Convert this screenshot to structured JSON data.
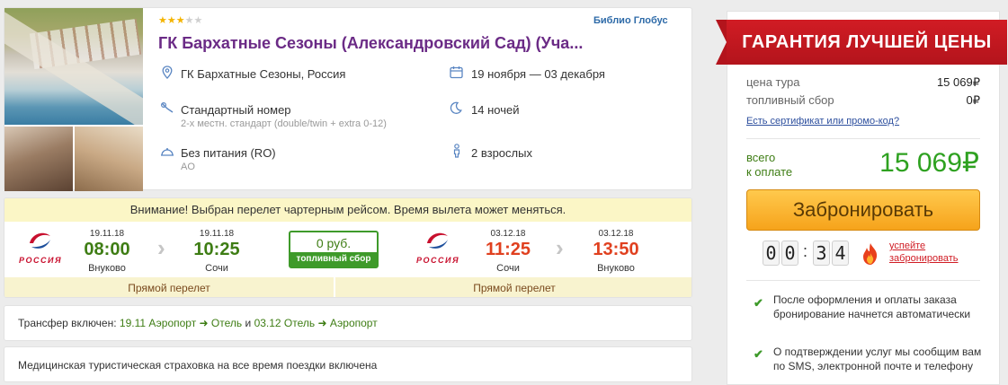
{
  "hotel": {
    "stars_filled": 3,
    "stars_total": 5,
    "operator": "Библио Глобус",
    "title": "ГК Бархатные Сезоны (Александровский Сад) (Уча...",
    "location": "ГК Бархатные Сезоны, Россия",
    "dates": "19 ноября — 03 декабря",
    "room": "Стандартный номер",
    "room_detail": "2-х местн. стандарт (double/twin + extra 0-12)",
    "nights": "14 ночей",
    "meal": "Без питания (RO)",
    "meal_code": "AO",
    "guests": "2 взрослых"
  },
  "flight": {
    "notice": "Внимание! Выбран перелет чартерным рейсом. Время вылета может меняться.",
    "airline": "РОССИЯ",
    "outbound": {
      "dep_date": "19.11.18",
      "dep_time": "08:00",
      "dep_place": "Внуково",
      "arr_date": "19.11.18",
      "arr_time": "10:25",
      "arr_place": "Сочи",
      "label": "Прямой перелет"
    },
    "fuel": {
      "price": "0 руб.",
      "label": "топливный сбор"
    },
    "return": {
      "dep_date": "03.12.18",
      "dep_time": "11:25",
      "dep_place": "Сочи",
      "arr_date": "03.12.18",
      "arr_time": "13:50",
      "arr_place": "Внуково",
      "label": "Прямой перелет"
    }
  },
  "transfer": {
    "prefix": "Трансфер включен:",
    "out": "19.11 Аэропорт ➜ Отель",
    "and": "и",
    "back": "03.12 Отель ➜ Аэропорт"
  },
  "insurance": "Медицинская туристическая страховка на все время поездки включена",
  "sidebar": {
    "ribbon": "ГАРАНТИЯ ЛУЧШЕЙ ЦЕНЫ",
    "tour_price_label": "цена тура",
    "tour_price_value": "15 069₽",
    "fuel_label": "топливный сбор",
    "fuel_value": "0₽",
    "promo_link": "Есть сертификат или промо-код?",
    "total_label_1": "всего",
    "total_label_2": "к оплате",
    "total_value": "15 069₽",
    "book_button": "Забронировать",
    "timer": [
      "0",
      "0",
      "3",
      "4"
    ],
    "hurry_1": "успейте",
    "hurry_2": "забронировать",
    "bullets": [
      "После оформления и оплаты заказа бронирование начнется автоматически",
      "О подтверждении услуг мы сообщим вам по SMS, электронной почте и телефону"
    ]
  },
  "colors": {
    "title": "#6b2b86",
    "green": "#3e7d14",
    "red": "#e0401f",
    "ribbon": "#d11c24",
    "button": "#f6a31b"
  },
  "icons": [
    "location-pin-icon",
    "calendar-icon",
    "bed-icon",
    "moon-icon",
    "meal-icon",
    "person-icon",
    "chevron-right-icon",
    "check-icon",
    "fire-icon"
  ]
}
